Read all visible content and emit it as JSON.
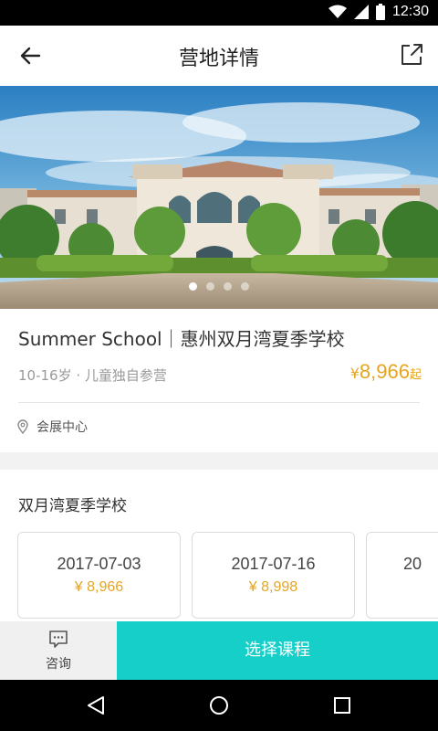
{
  "status_bar": {
    "time": "12:30",
    "icons": [
      "wifi-icon",
      "signal-icon",
      "battery-icon"
    ]
  },
  "app_bar": {
    "title": "营地详情",
    "back_icon": "arrow-left-icon",
    "share_icon": "external-share-icon"
  },
  "carousel": {
    "page_count": 4,
    "active_index": 0
  },
  "camp": {
    "title": "Summer School｜惠州双月湾夏季学校",
    "subtitle": "10-16岁 · 儿童独自参营",
    "price_currency": "¥",
    "price_value": "8,966",
    "price_suffix": "起",
    "location": "会展中心"
  },
  "sessions": {
    "title": "双月湾夏季学校",
    "items": [
      {
        "date": "2017-07-03",
        "price": "¥ 8,966"
      },
      {
        "date": "2017-07-16",
        "price": "¥ 8,998"
      },
      {
        "date": "20",
        "price": ""
      }
    ]
  },
  "bottom_bar": {
    "consult_label": "咨询",
    "select_label": "选择课程"
  },
  "colors": {
    "accent": "#16cfc9",
    "price": "#e5a521"
  }
}
